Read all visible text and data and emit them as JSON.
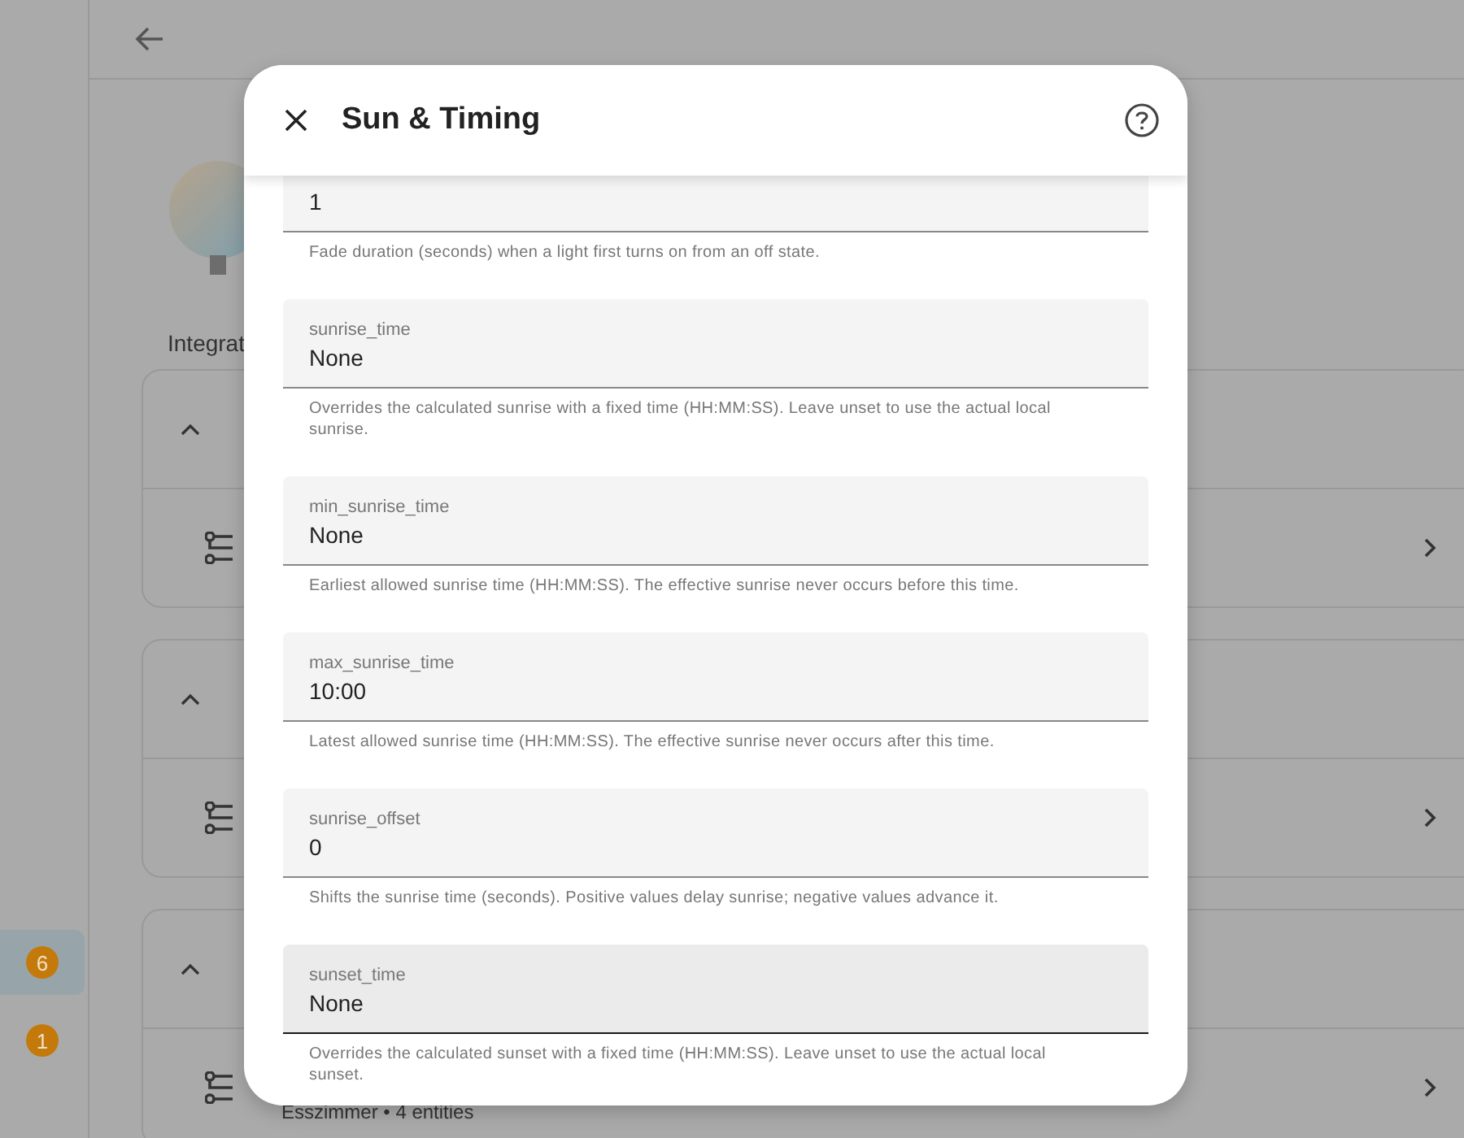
{
  "nav_badges": [
    {
      "count": "6",
      "selected": true
    },
    {
      "count": "1",
      "selected": false
    }
  ],
  "section_heading": "Integrat",
  "groups": [
    {
      "expanded": true
    },
    {
      "expanded": true
    },
    {
      "expanded": true,
      "entry": "Esszimmer • 4 entities"
    }
  ],
  "dialog": {
    "title": "Sun & Timing",
    "fields": [
      {
        "value": "1",
        "helper": "Fade duration (seconds) when a light first turns on from an off state.",
        "hovered": false
      },
      {
        "label": "sunrise_time",
        "value": "None",
        "helper": "Overrides the calculated sunrise with a fixed time (HH:MM:SS). Leave unset to use the actual local sunrise.",
        "hovered": false
      },
      {
        "label": "min_sunrise_time",
        "value": "None",
        "helper": "Earliest allowed sunrise time (HH:MM:SS). The effective sunrise never occurs before this time.",
        "hovered": false
      },
      {
        "label": "max_sunrise_time",
        "value": "10:00",
        "helper": "Latest allowed sunrise time (HH:MM:SS). The effective sunrise never occurs after this time.",
        "hovered": false
      },
      {
        "label": "sunrise_offset",
        "value": "0",
        "helper": "Shifts the sunrise time (seconds). Positive values delay sunrise; negative values advance it.",
        "hovered": false
      },
      {
        "label": "sunset_time",
        "value": "None",
        "helper": "Overrides the calculated sunset with a fixed time (HH:MM:SS). Leave unset to use the actual local sunset.",
        "hovered": true
      }
    ]
  }
}
